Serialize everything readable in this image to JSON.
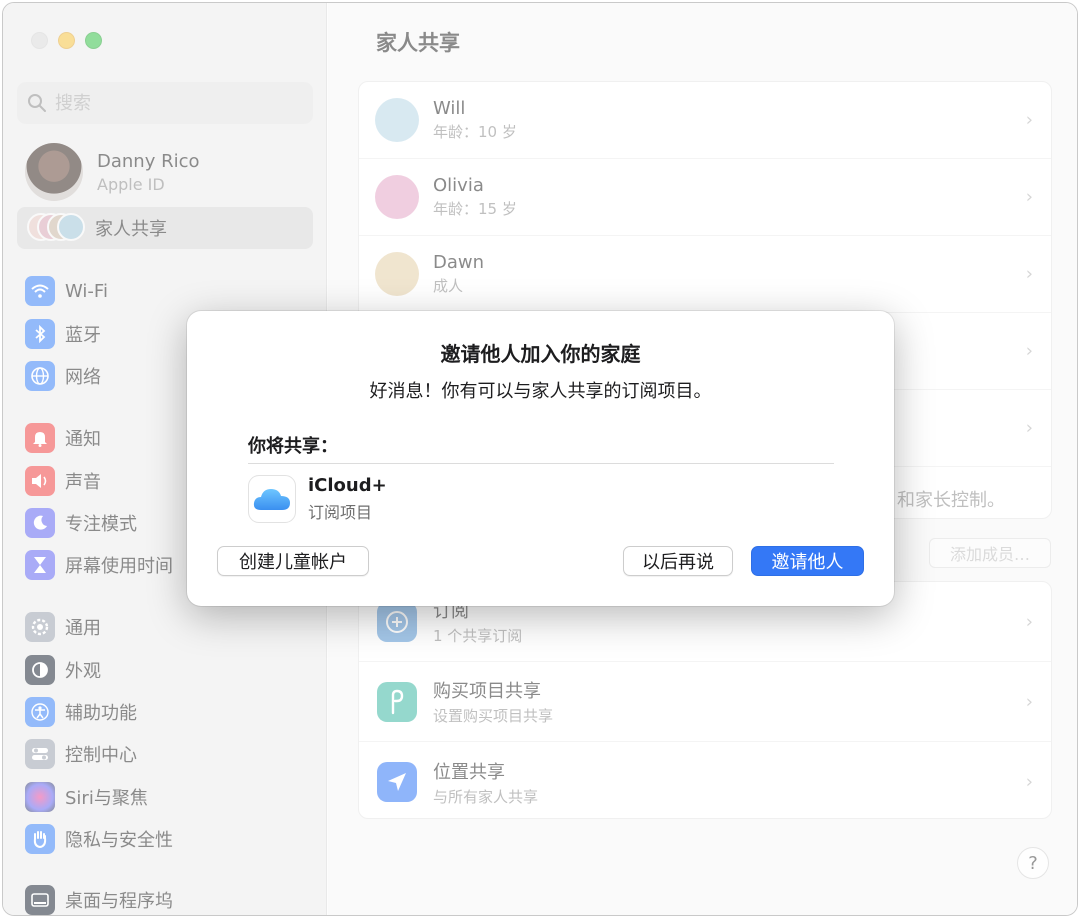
{
  "window": {
    "traffic_lights": {
      "close_color": "#d9d9d9",
      "minimize_color": "#f5c342",
      "zoom_color": "#38c149"
    }
  },
  "sidebar": {
    "search": {
      "placeholder": "搜索"
    },
    "account": {
      "name": "Danny Rico",
      "subtitle": "Apple ID"
    },
    "family_sharing": {
      "label": "家人共享"
    },
    "items": [
      {
        "label": "Wi-Fi",
        "icon": "wifi-icon",
        "color": "#3b82f6"
      },
      {
        "label": "蓝牙",
        "icon": "bluetooth-icon",
        "color": "#3b82f6"
      },
      {
        "label": "网络",
        "icon": "globe-icon",
        "color": "#3b82f6"
      },
      {
        "label": "通知",
        "icon": "bell-icon",
        "color": "#ef4444"
      },
      {
        "label": "声音",
        "icon": "speaker-icon",
        "color": "#ef4444"
      },
      {
        "label": "专注模式",
        "icon": "moon-icon",
        "color": "#6366f1"
      },
      {
        "label": "屏幕使用时间",
        "icon": "hourglass-icon",
        "color": "#6366f1"
      },
      {
        "label": "通用",
        "icon": "gear-icon",
        "color": "#9ca3af"
      },
      {
        "label": "外观",
        "icon": "appearance-icon",
        "color": "#1f2937"
      },
      {
        "label": "辅助功能",
        "icon": "accessibility-icon",
        "color": "#3b82f6"
      },
      {
        "label": "控制中心",
        "icon": "toggles-icon",
        "color": "#9ca3af"
      },
      {
        "label": "Siri与聚焦",
        "icon": "siri-icon",
        "color": "#8b5cf6"
      },
      {
        "label": "隐私与安全性",
        "icon": "hand-icon",
        "color": "#3b82f6"
      },
      {
        "label": "桌面与程序坞",
        "icon": "dock-icon",
        "color": "#1f2937"
      }
    ]
  },
  "main": {
    "title": "家人共享",
    "members": [
      {
        "name": "Will",
        "subtitle": "年龄：10 岁",
        "avatar_color": "#b9d7e6"
      },
      {
        "name": "Olivia",
        "subtitle": "年龄：15 岁",
        "avatar_color": "#e3a7c6"
      },
      {
        "name": "Dawn",
        "subtitle": "成人",
        "avatar_color": "#e4cfa8"
      }
    ],
    "note_text": "和家长控制。",
    "add_member_label": "添加成员…",
    "features": [
      {
        "name": "订阅",
        "subtitle": "1 个共享订阅",
        "icon": "plus-circle-icon",
        "color": "#5a9ad8"
      },
      {
        "name": "购买项目共享",
        "subtitle": "设置购买项目共享",
        "icon": "purchase-sharing-icon",
        "color": "#3fb9a4"
      },
      {
        "name": "位置共享",
        "subtitle": "与所有家人共享",
        "icon": "location-arrow-icon",
        "color": "#3478f6"
      }
    ],
    "help_label": "?"
  },
  "dialog": {
    "title": "邀请他人加入你的家庭",
    "subtitle": "好消息！你有可以与家人共享的订阅项目。",
    "share_label": "你将共享：",
    "item": {
      "name": "iCloud+",
      "subtitle": "订阅项目",
      "icon": "icloud-icon"
    },
    "buttons": {
      "create_child": "创建儿童帐户",
      "later": "以后再说",
      "invite": "邀请他人"
    }
  }
}
